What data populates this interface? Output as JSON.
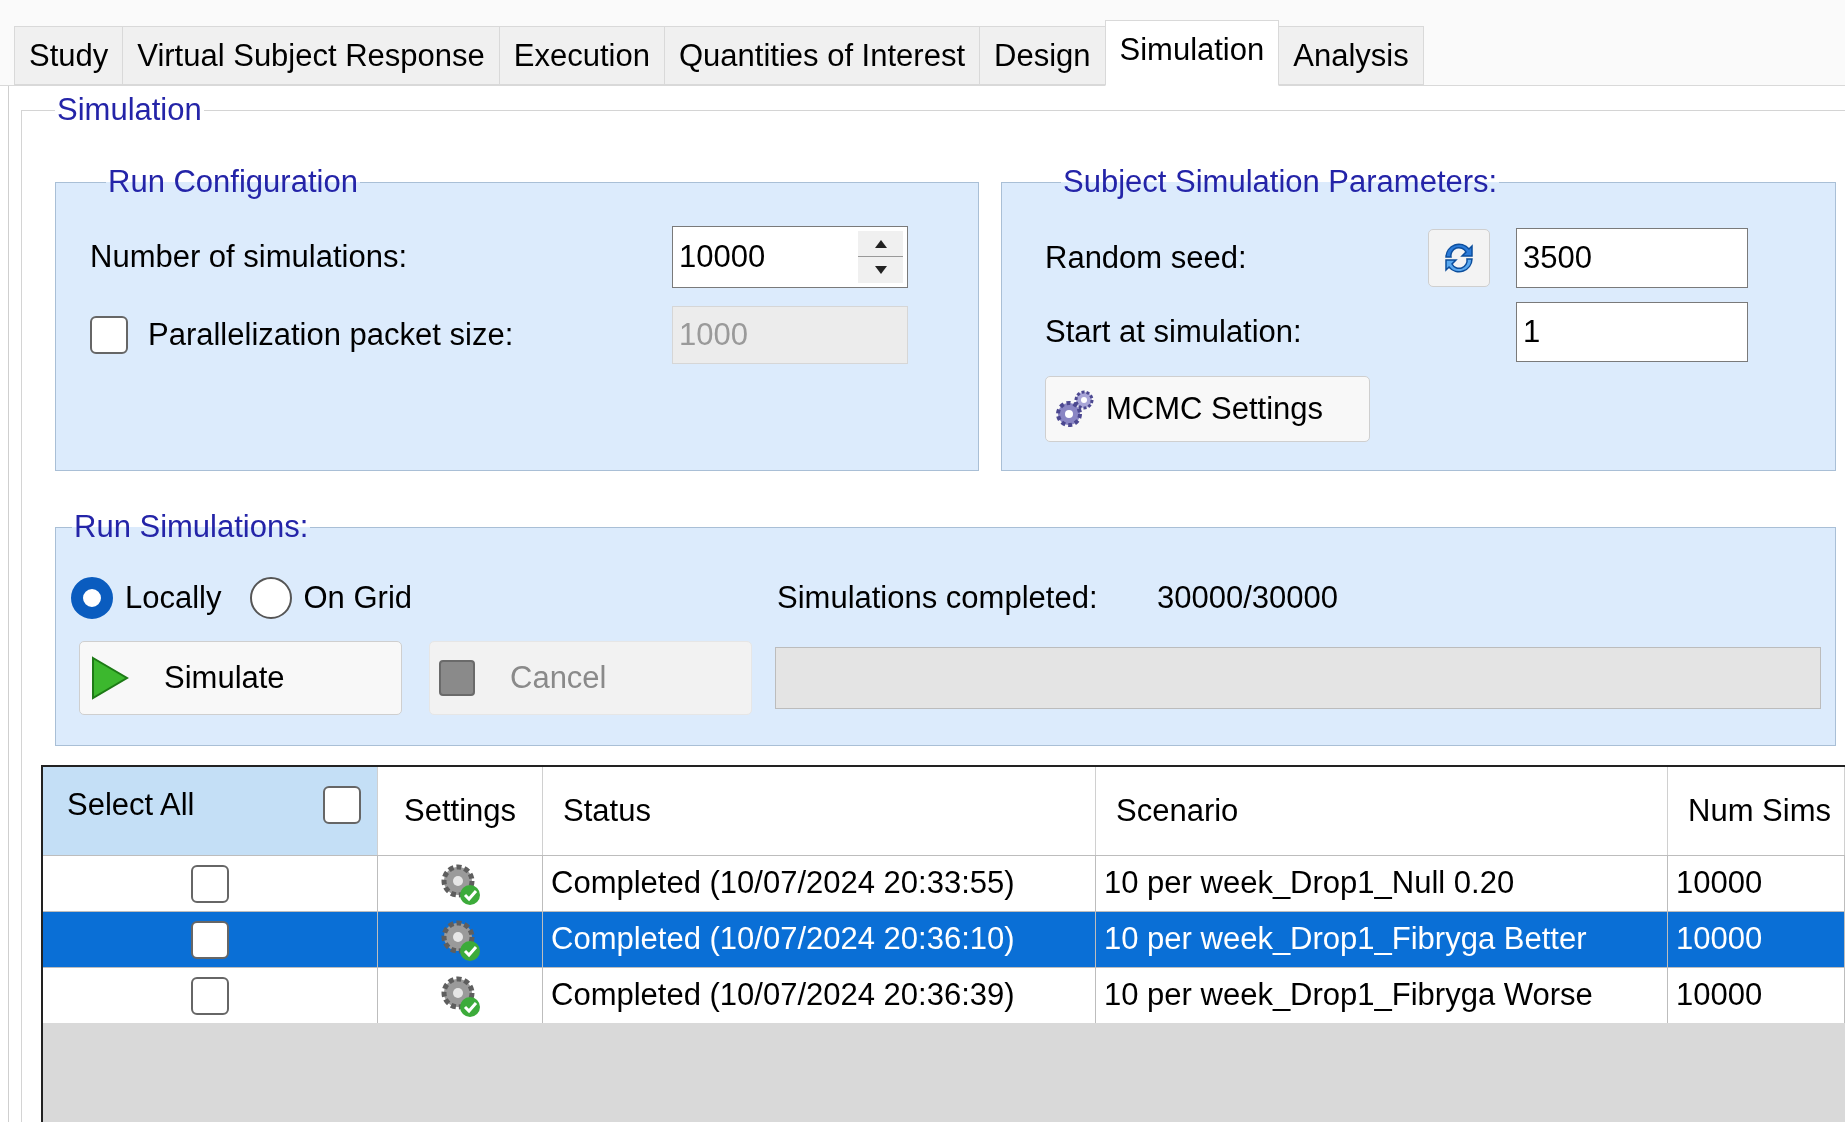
{
  "tabs": [
    {
      "label": "Study",
      "selected": false
    },
    {
      "label": "Virtual Subject Response",
      "selected": false
    },
    {
      "label": "Execution",
      "selected": false
    },
    {
      "label": "Quantities of Interest",
      "selected": false
    },
    {
      "label": "Design",
      "selected": false
    },
    {
      "label": "Simulation",
      "selected": true
    },
    {
      "label": "Analysis",
      "selected": false
    }
  ],
  "group_title": "Simulation",
  "run_configuration": {
    "title": "Run Configuration",
    "number_of_simulations": {
      "label": "Number of simulations:",
      "value": "10000"
    },
    "parallelization": {
      "label": "Parallelization packet size:",
      "checked": false,
      "value": "1000",
      "disabled": true
    }
  },
  "subject_simulation_parameters": {
    "title": "Subject Simulation Parameters:",
    "random_seed": {
      "label": "Random seed:",
      "value": "3500"
    },
    "start_at_simulation": {
      "label": "Start at simulation:",
      "value": "1"
    },
    "mcmc_button": "MCMC Settings"
  },
  "run_simulations": {
    "title": "Run Simulations:",
    "modes": [
      {
        "label": "Locally",
        "selected": true
      },
      {
        "label": "On Grid",
        "selected": false
      }
    ],
    "completed_label": "Simulations completed:",
    "completed_value": "30000/30000",
    "progress": {
      "level": 0
    },
    "buttons": [
      {
        "kind": "simulate",
        "label": "Simulate",
        "disabled": false
      },
      {
        "kind": "cancel",
        "label": "Cancel",
        "disabled": true
      }
    ]
  },
  "table": {
    "select_all": {
      "label": "Select All",
      "checked": false
    },
    "columns": [
      "Settings",
      "Status",
      "Scenario",
      "Num Sims"
    ],
    "rows": [
      {
        "checked": false,
        "selected": false,
        "status": "Completed (10/07/2024 20:33:55)",
        "scenario": "10 per week_Drop1_Null 0.20",
        "num_sims": "10000"
      },
      {
        "checked": false,
        "selected": true,
        "status": "Completed (10/07/2024 20:36:10)",
        "scenario": "10 per week_Drop1_Fibryga Better",
        "num_sims": "10000"
      },
      {
        "checked": false,
        "selected": false,
        "status": "Completed (10/07/2024 20:36:39)",
        "scenario": "10 per week_Drop1_Fibryga Worse",
        "num_sims": "10000"
      }
    ]
  }
}
